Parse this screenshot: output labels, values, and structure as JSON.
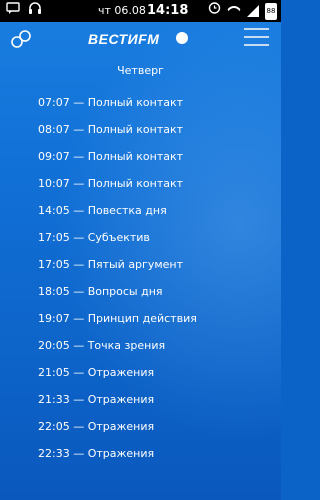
{
  "statusbar": {
    "date": "чт 06.08",
    "time": "14:18",
    "battery_level": "88"
  },
  "header": {
    "logo_text": "ВЕСТИFM"
  },
  "day_title": "Четверг",
  "schedule": [
    "07:07 — Полный контакт",
    "08:07 — Полный контакт",
    "09:07 — Полный контакт",
    "10:07 — Полный контакт",
    "14:05 — Повестка дня",
    "17:05 — Субъектив",
    "17:05 — Пятый аргумент",
    "18:05 — Вопросы дня",
    "19:07 — Принцип действия",
    "20:05 — Точка зрения",
    "21:05 — Отражения",
    "21:33 — Отражения",
    "22:05 — Отражения",
    "22:33 — Отражения"
  ]
}
